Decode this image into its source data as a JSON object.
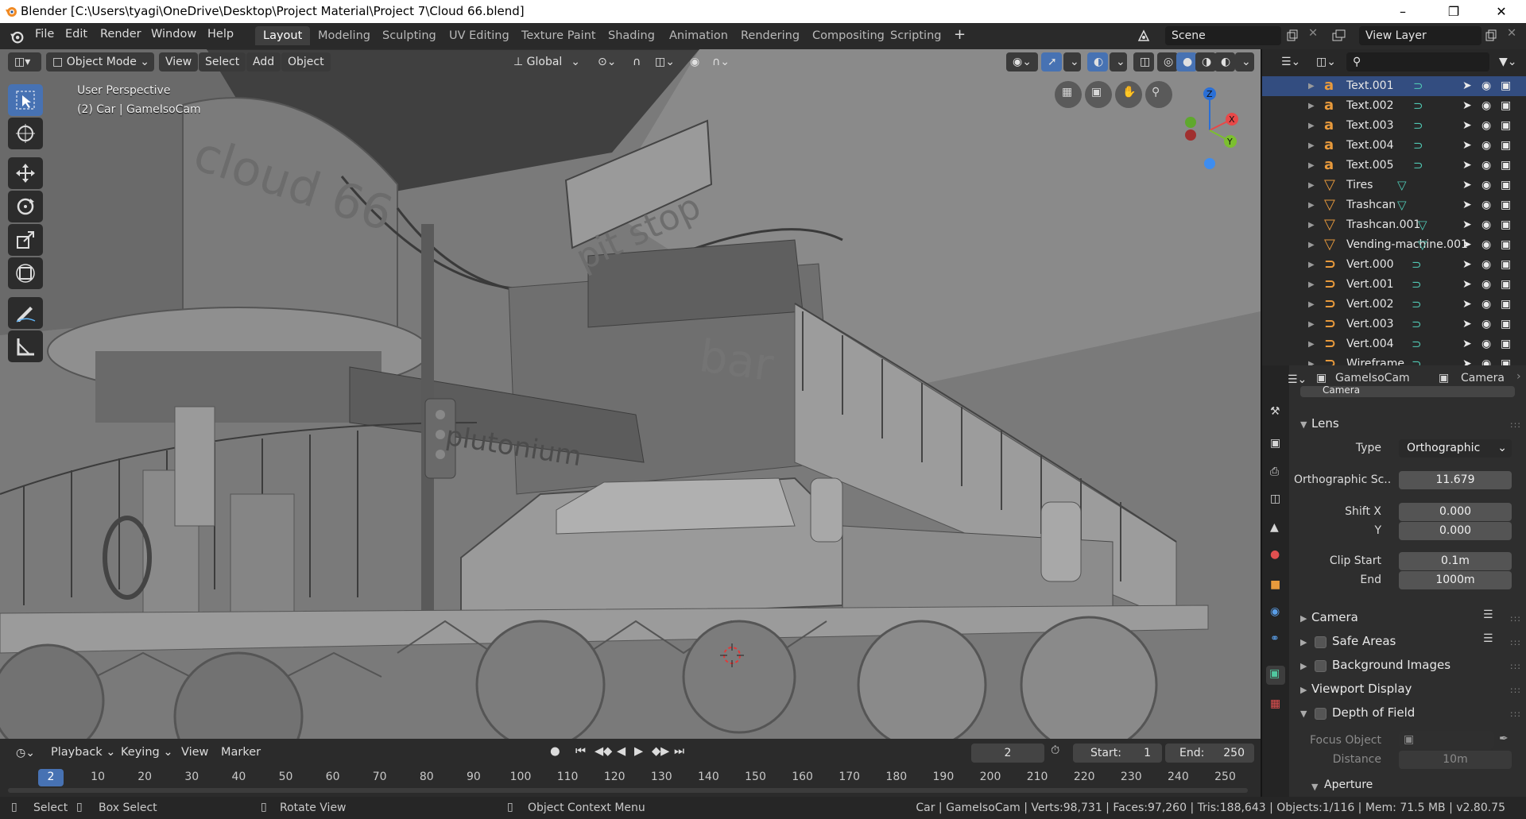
{
  "window": {
    "title": "Blender [C:\\Users\\tyagi\\OneDrive\\Desktop\\Project Material\\Project 7\\Cloud 66.blend]"
  },
  "menus": [
    "File",
    "Edit",
    "Render",
    "Window",
    "Help"
  ],
  "workspaces": [
    "Layout",
    "Modeling",
    "Sculpting",
    "UV Editing",
    "Texture Paint",
    "Shading",
    "Animation",
    "Rendering",
    "Compositing",
    "Scripting"
  ],
  "active_workspace": "Layout",
  "scene_name": "Scene",
  "view_layer": "View Layer",
  "viewport": {
    "mode": "Object Mode",
    "header_menus": [
      "View",
      "Select",
      "Add",
      "Object"
    ],
    "transform_orientation": "Global",
    "perspective_label": "User Perspective",
    "object_label": "(2) Car | GameIsoCam",
    "gizmo_axes": {
      "x": "X",
      "y": "Y",
      "z": "Z"
    },
    "scene_signs": {
      "sign1": "cloud 66",
      "sign2": "pit stop",
      "sign3": "plutonium",
      "sign4": "bar"
    }
  },
  "outliner": {
    "items": [
      {
        "name": "Text.001",
        "type": "text",
        "selected": true
      },
      {
        "name": "Text.002",
        "type": "text",
        "selected": false
      },
      {
        "name": "Text.003",
        "type": "text",
        "selected": false
      },
      {
        "name": "Text.004",
        "type": "text",
        "selected": false
      },
      {
        "name": "Text.005",
        "type": "text",
        "selected": false
      },
      {
        "name": "Tires",
        "type": "mesh",
        "selected": false
      },
      {
        "name": "Trashcan",
        "type": "mesh",
        "selected": false
      },
      {
        "name": "Trashcan.001",
        "type": "mesh",
        "selected": false
      },
      {
        "name": "Vending-machine.001",
        "type": "mesh",
        "selected": false
      },
      {
        "name": "Vert.000",
        "type": "curve",
        "selected": false
      },
      {
        "name": "Vert.001",
        "type": "curve",
        "selected": false
      },
      {
        "name": "Vert.002",
        "type": "curve",
        "selected": false
      },
      {
        "name": "Vert.003",
        "type": "curve",
        "selected": false
      },
      {
        "name": "Vert.004",
        "type": "curve",
        "selected": false
      },
      {
        "name": "Wireframe",
        "type": "curve",
        "selected": false
      }
    ]
  },
  "properties": {
    "object_name": "GameIsoCam",
    "data_name": "Camera",
    "top_field": "Camera",
    "lens": {
      "section": "Lens",
      "type_label": "Type",
      "type_value": "Orthographic",
      "ortho_label": "Orthographic Sc..",
      "ortho_value": "11.679",
      "shift_x_label": "Shift X",
      "shift_x_value": "0.000",
      "shift_y_label": "Y",
      "shift_y_value": "0.000",
      "clip_start_label": "Clip Start",
      "clip_start_value": "0.1m",
      "clip_end_label": "End",
      "clip_end_value": "1000m"
    },
    "sections": {
      "camera": "Camera",
      "safe_areas": "Safe Areas",
      "background_images": "Background Images",
      "viewport_display": "Viewport Display",
      "depth_of_field": "Depth of Field"
    },
    "dof": {
      "focus_object_label": "Focus Object",
      "distance_label": "Distance",
      "distance_value": "10m",
      "aperture": "Aperture"
    }
  },
  "timeline": {
    "menus": [
      "Playback",
      "Keying",
      "View",
      "Marker"
    ],
    "current_frame": "2",
    "start_label": "Start:",
    "start": "1",
    "end_label": "End:",
    "end": "250",
    "ticks": [
      "2",
      "10",
      "20",
      "30",
      "40",
      "50",
      "60",
      "70",
      "80",
      "90",
      "100",
      "110",
      "120",
      "130",
      "140",
      "150",
      "160",
      "170",
      "180",
      "190",
      "200",
      "210",
      "220",
      "230",
      "240",
      "250"
    ]
  },
  "statusbar": {
    "select": "Select",
    "box_select": "Box Select",
    "rotate_view": "Rotate View",
    "context_menu": "Object Context Menu",
    "stats": "Car | GameIsoCam | Verts:98,731 | Faces:97,260 | Tris:188,643 | Objects:1/116 | Mem: 71.5 MB | v2.80.75"
  },
  "colors": {
    "accent": "#4772b3",
    "selected_row": "#334d80",
    "header_bg": "#2a2a2a",
    "viewport_bg": "#7d7d7d"
  }
}
